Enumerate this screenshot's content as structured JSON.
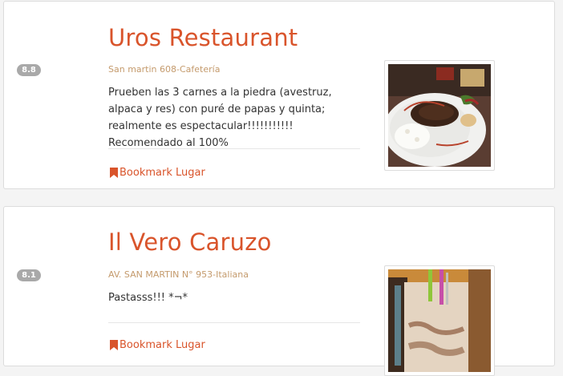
{
  "colors": {
    "accent": "#d9542b",
    "address": "#c49a6c",
    "score_badge": "#a9a9a9"
  },
  "places": [
    {
      "score": "8.8",
      "name": "Uros Restaurant",
      "address": "San martin 608-Cafetería",
      "review": "Prueben las 3 carnes a la piedra (avestruz, alpaca y res) con puré de papas y quinta; realmente es espectacular!!!!!!!!!!! Recomendado al 100%",
      "bookmark_label": "Bookmark Lugar",
      "bookmark_icon": "bookmark-icon",
      "photo": "photo of steak with rice and salad"
    },
    {
      "score": "8.1",
      "name": "Il Vero Caruzo",
      "address": "AV. SAN MARTIN N° 953-Italiana",
      "review": "Pastasss!!! *¬*",
      "bookmark_label": "Bookmark Lugar",
      "bookmark_icon": "bookmark-icon",
      "photo": "photo of iced drink with straws"
    }
  ]
}
